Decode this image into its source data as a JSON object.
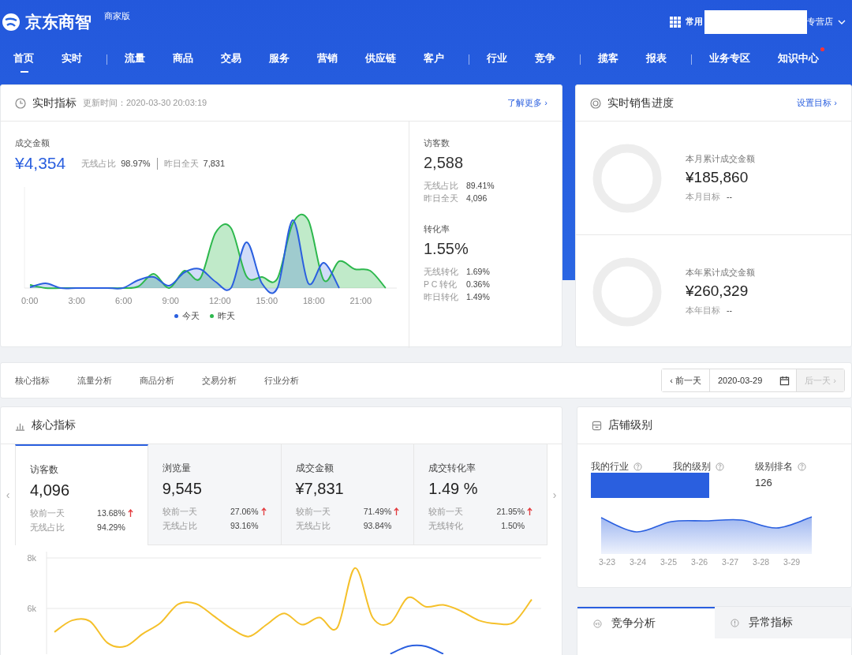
{
  "header": {
    "logo": "京东商智",
    "edition": "商家版",
    "shortcut": "常用",
    "shop": "专营店"
  },
  "nav": [
    {
      "items": [
        {
          "label": "首页",
          "selected": true,
          "dot": false
        },
        {
          "label": "实时",
          "selected": false,
          "dot": false
        }
      ]
    },
    {
      "items": [
        {
          "label": "流量",
          "selected": false,
          "dot": false
        },
        {
          "label": "商品",
          "selected": false,
          "dot": false
        },
        {
          "label": "交易",
          "selected": false,
          "dot": false
        },
        {
          "label": "服务",
          "selected": false,
          "dot": false
        },
        {
          "label": "营销",
          "selected": false,
          "dot": false
        },
        {
          "label": "供应链",
          "selected": false,
          "dot": false
        },
        {
          "label": "客户",
          "selected": false,
          "dot": false
        }
      ]
    },
    {
      "items": [
        {
          "label": "行业",
          "selected": false,
          "dot": false
        },
        {
          "label": "竞争",
          "selected": false,
          "dot": false
        }
      ]
    },
    {
      "items": [
        {
          "label": "揽客",
          "selected": false,
          "dot": false
        },
        {
          "label": "报表",
          "selected": false,
          "dot": false
        }
      ]
    },
    {
      "items": [
        {
          "label": "业务专区",
          "selected": false,
          "dot": false
        },
        {
          "label": "知识中心",
          "selected": false,
          "dot": true
        }
      ]
    }
  ],
  "realtime": {
    "title": "实时指标",
    "updated": "更新时间：2020-03-30 20:03:19",
    "link": "了解更多 ›",
    "main": {
      "label": "成交金额",
      "value": "¥4,354",
      "stats": [
        {
          "label": "无线占比",
          "value": "98.97%"
        },
        {
          "label": "昨日全天",
          "value": "7,831"
        }
      ]
    },
    "axis": [
      "0:00",
      "3:00",
      "6:00",
      "9:00",
      "12:00",
      "15:00",
      "18:00",
      "21:00"
    ],
    "legend": [
      {
        "label": "今天",
        "color": "#2a5fdf"
      },
      {
        "label": "昨天",
        "color": "#2db84d"
      }
    ],
    "side": [
      {
        "label": "访客数",
        "value": "2,588",
        "stats": [
          {
            "label": "无线占比",
            "value": "89.41%"
          },
          {
            "label": "昨日全天",
            "value": "4,096"
          }
        ]
      },
      {
        "label": "转化率",
        "value": "1.55%",
        "stats": [
          {
            "label": "无线转化",
            "value": "1.69%"
          },
          {
            "label": "P C 转化",
            "value": "0.36%"
          },
          {
            "label": "昨日转化",
            "value": "1.49%"
          }
        ]
      }
    ]
  },
  "sales_progress": {
    "title": "实时销售进度",
    "link": "设置目标 ›",
    "blocks": [
      {
        "label": "本月累计成交金额",
        "value": "¥185,860",
        "target_label": "本月目标",
        "target": "--"
      },
      {
        "label": "本年累计成交金额",
        "value": "¥260,329",
        "target_label": "本年目标",
        "target": "--"
      }
    ]
  },
  "analysis_tabs": [
    {
      "label": "核心指标",
      "selected": false
    },
    {
      "label": "流量分析",
      "selected": false
    },
    {
      "label": "商品分析",
      "selected": false
    },
    {
      "label": "交易分析",
      "selected": false
    },
    {
      "label": "行业分析",
      "selected": false
    }
  ],
  "date_nav": {
    "prev": "‹ 前一天",
    "date": "2020-03-29",
    "next": "后一天 ›",
    "next_disabled": true
  },
  "core": {
    "title": "核心指标",
    "prev": "‹",
    "next": "›",
    "metrics": [
      {
        "label": "访客数",
        "value": "4,096",
        "selected": true,
        "change": {
          "label": "较前一天",
          "value": "13.68%",
          "rising": true
        },
        "share": {
          "label": "无线占比",
          "value": "94.29%"
        }
      },
      {
        "label": "浏览量",
        "value": "9,545",
        "selected": false,
        "change": {
          "label": "较前一天",
          "value": "27.06%",
          "rising": true
        },
        "share": {
          "label": "无线占比",
          "value": "93.16%"
        }
      },
      {
        "label": "成交金额",
        "value": "¥7,831",
        "selected": false,
        "change": {
          "label": "较前一天",
          "value": "71.49%",
          "rising": true
        },
        "share": {
          "label": "无线占比",
          "value": "93.84%"
        }
      },
      {
        "label": "成交转化率",
        "value": "1.49 %",
        "selected": false,
        "change": {
          "label": "较前一天",
          "value": "21.95%",
          "rising": true
        },
        "share": {
          "label": "无线转化",
          "value": "1.50%"
        }
      }
    ],
    "chart_data": {
      "type": "line",
      "ylim": [
        4190,
        8250
      ],
      "yticks": [
        {
          "value": 6000,
          "label": "6k"
        },
        {
          "value": 8000,
          "label": "8k"
        }
      ],
      "series": [
        {
          "color": "#f5c02a",
          "values": [
            5070,
            5530,
            5500,
            4640,
            4500,
            5000,
            5430,
            6170,
            6190,
            5710,
            5210,
            4890,
            5360,
            5810,
            5360,
            5640,
            5240,
            7600,
            5640,
            5430,
            6430,
            6070,
            6140,
            5900,
            5530,
            5400,
            5460,
            6360
          ]
        },
        {
          "color": "#2a5fdf",
          "values": [
            null,
            null,
            null,
            null,
            null,
            null,
            null,
            null,
            null,
            null,
            null,
            null,
            null,
            null,
            null,
            null,
            null,
            null,
            null,
            4200,
            4500,
            4500,
            4200,
            null,
            null,
            null,
            null,
            null
          ]
        }
      ]
    }
  },
  "store_level": {
    "title": "店铺级别",
    "stats": [
      {
        "label": "我的行业"
      },
      {
        "label": "我的级别"
      },
      {
        "label": "级别排名",
        "value": "126"
      }
    ],
    "axis": [
      "3-23",
      "3-24",
      "3-25",
      "3-26",
      "3-27",
      "3-28",
      "3-29"
    ]
  },
  "bottom_tabs": [
    {
      "label": "竞争分析",
      "selected": true,
      "kind": "vs"
    },
    {
      "label": "异常指标",
      "selected": false,
      "kind": "alert"
    }
  ]
}
